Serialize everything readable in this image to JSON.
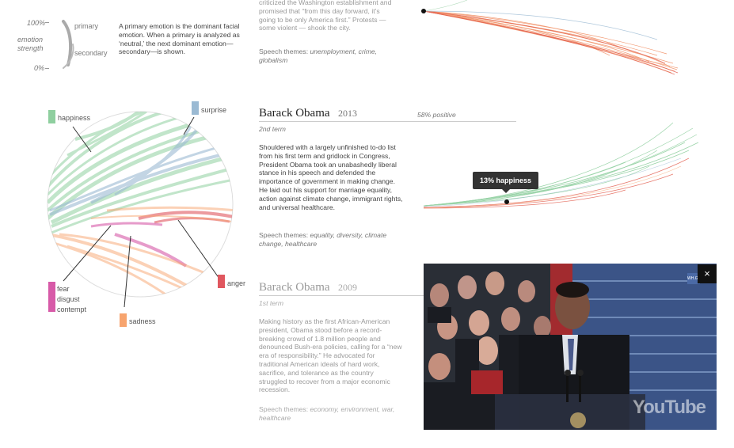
{
  "legend": {
    "top_pct": "100%",
    "bottom_pct": "0%",
    "axis_label_1": "emotion",
    "axis_label_2": "strength",
    "primary": "primary",
    "secondary": "secondary",
    "description": "A primary emotion is the dominant facial emotion. When a primary is analyzed as ‘neutral,’ the next dominant emotion—secondary—is shown."
  },
  "top_speech": {
    "lines": [
      "criticized the Washington establishment and",
      "promised that “from this day forward, it’s",
      "going to be only America first.” Protests —",
      "some violent — shook the city."
    ],
    "themes_label": "Speech themes:",
    "themes": "unemployment, crime, globalism"
  },
  "emotion_wheel": {
    "happiness": "happiness",
    "surprise": "surprise",
    "anger": "anger",
    "fear": "fear",
    "disgust": "disgust",
    "contempt": "contempt",
    "sadness": "sadness",
    "colors": {
      "happiness": "#8fcf9f",
      "surprise": "#9bbad3",
      "anger": "#e0575f",
      "fear_disgust_contempt": "#d75aa8",
      "sadness": "#f7a46e"
    }
  },
  "obama2013": {
    "name": "Barack Obama",
    "year": "2013",
    "positive": "58% positive",
    "term": "2nd term",
    "description": "Shouldered with a largely unfinished to-do list from his first term and gridlock in Congress, President Obama took an unabashedly liberal stance in his speech and defended the importance of government in making change. He laid out his support for marriage equality, action against climate change, immigrant rights, and universal healthcare.",
    "themes_label": "Speech themes:",
    "themes": "equality, diversity, climate change, healthcare",
    "tooltip": "13% happiness"
  },
  "obama2009": {
    "name": "Barack Obama",
    "year": "2009",
    "term": "1st term",
    "description": "Making history as the first African-American president, Obama stood before a record-breaking crowd of 1.8 million people and denounced Bush-era policies, calling for a “new era of responsibility.” He advocated for traditional American ideals of hard work, sacrifice, and tolerance as the country struggled to recover from a major economic recession.",
    "themes_label": "Speech themes:",
    "themes": "economy, environment, war, healthcare"
  },
  "video": {
    "close": "×",
    "logo": "YouTube",
    "badge": "WH.GOV"
  }
}
